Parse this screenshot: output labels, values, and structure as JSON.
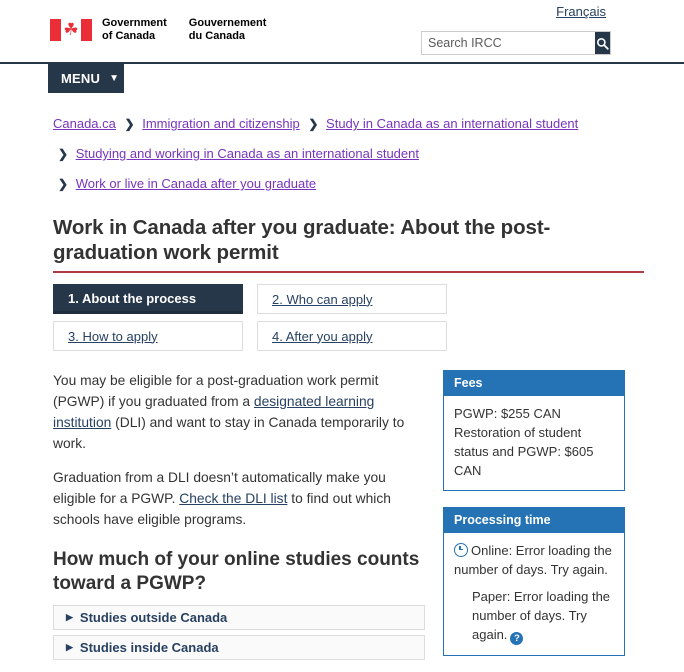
{
  "header": {
    "lang_link": "Français",
    "wordmark_en_line1": "Government",
    "wordmark_en_line2": "of Canada",
    "wordmark_fr_line1": "Gouvernement",
    "wordmark_fr_line2": "du Canada",
    "flag_leaf": "☘",
    "search_placeholder": "Search IRCC",
    "search_value": "",
    "search_button_label": "Search",
    "menu_label": "MENU",
    "menu_caret": "❯"
  },
  "breadcrumb": {
    "separator": "❯",
    "line1": [
      {
        "label": "Canada.ca"
      },
      {
        "label": "Immigration and citizenship"
      },
      {
        "label": "Study in Canada as an international student"
      }
    ],
    "line2": {
      "label": "Studying and working in Canada as an international student"
    },
    "line3": {
      "label": "Work or live in Canada after you graduate"
    }
  },
  "page": {
    "title": "Work in Canada after you graduate: About the post-graduation work permit"
  },
  "tabs": [
    {
      "label": "1. About the process",
      "active": true
    },
    {
      "label": "2. Who can apply",
      "active": false
    },
    {
      "label": "3. How to apply",
      "active": false
    },
    {
      "label": "4. After you apply",
      "active": false
    }
  ],
  "main": {
    "para1_part1": "You may be eligible for a post-graduation work permit (PGWP) if you graduated from a ",
    "para1_link": "designated learning institution",
    "para1_part2": " (DLI) and want to stay in Canada temporarily to work.",
    "para2_part1": "Graduation from a DLI doesn’t automatically make you eligible for a PGWP. ",
    "para2_link": "Check the DLI list",
    "para2_part2": " to find out which schools have eligible programs.",
    "section_title": "How much of your online studies counts toward a PGWP?",
    "accordions": [
      {
        "label": "Studies outside Canada",
        "caret": "▶"
      },
      {
        "label": "Studies inside Canada",
        "caret": "▶"
      }
    ]
  },
  "sidebar": {
    "fees": {
      "heading": "Fees",
      "line1": "PGWP: $255 CAN",
      "line2": "Restoration of student status and PGWP: $605 CAN"
    },
    "processing_time": {
      "heading": "Processing time",
      "online_label": "Online: Error loading the number of days. Try again.",
      "paper_label": "Paper: Error loading the number of days. Try again.",
      "help_glyph": "?"
    }
  },
  "colors": {
    "navy": "#26374A",
    "panel_blue": "#2572B4",
    "link_purple": "#7834bc",
    "link_blue": "#284162",
    "title_rule_red": "#AF3C43",
    "flag_red": "#EA2D37"
  }
}
